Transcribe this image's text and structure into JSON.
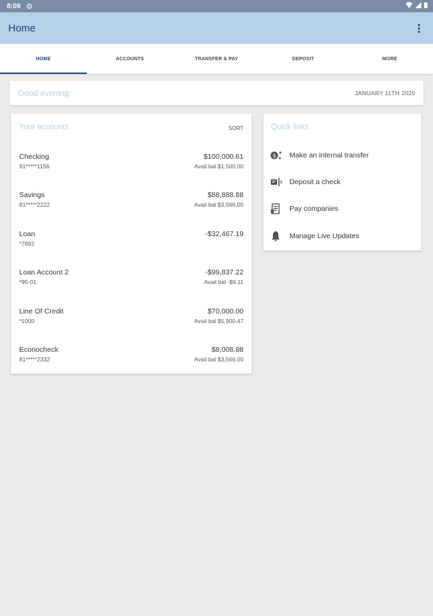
{
  "status_bar": {
    "time": "8:09",
    "gear_icon": "gear-icon",
    "wifi_icon": "wifi-icon",
    "signal_icon": "signal-icon",
    "battery_icon": "battery-icon"
  },
  "app_bar": {
    "title": "Home",
    "overflow_icon": "more-vert-icon"
  },
  "tabs": [
    {
      "label": "HOME",
      "active": true
    },
    {
      "label": "ACCOUNTS",
      "active": false
    },
    {
      "label": "TRANSFER & PAY",
      "active": false
    },
    {
      "label": "DEPOSIT",
      "active": false
    },
    {
      "label": "MORE",
      "active": false
    }
  ],
  "greeting": {
    "text": "Good evening",
    "date": "JANUARY 11TH 2020"
  },
  "accounts": {
    "title": "Your accounts",
    "sort_label": "SORT",
    "items": [
      {
        "name": "Checking",
        "number": "91*****1156",
        "balance": "$100,000.61",
        "avail": "Avail bal $1,500.00"
      },
      {
        "name": "Savings",
        "number": "81*****2222",
        "balance": "$88,888.88",
        "avail": "Avail bal $3,566.00"
      },
      {
        "name": "Loan",
        "number": "*7892",
        "balance": "-$32,467.19",
        "avail": ""
      },
      {
        "name": "Loan Account 2",
        "number": "*95-01",
        "balance": "-$99,837.22",
        "avail": "Avail bal -$9.11"
      },
      {
        "name": "Line Of Credit",
        "number": "*1000",
        "balance": "$70,000.00",
        "avail": "Avail bal $5,900.47"
      },
      {
        "name": "Econocheck",
        "number": "81*****2332",
        "balance": "$8,008.88",
        "avail": "Avail bal $3,566.00"
      }
    ]
  },
  "quick_links": {
    "title": "Quick links",
    "items": [
      {
        "label": "Make an internal transfer",
        "icon": "transfer-icon"
      },
      {
        "label": "Deposit a check",
        "icon": "deposit-check-icon"
      },
      {
        "label": "Pay companies",
        "icon": "bill-pay-icon"
      },
      {
        "label": "Manage Live Updates",
        "icon": "bell-icon"
      }
    ]
  },
  "colors": {
    "app_bar": "#b7d0ea",
    "status_bar": "#7a8ca6",
    "accent": "#1b3f73",
    "background": "#ececec",
    "subtle_title": "#b9d1ea"
  }
}
